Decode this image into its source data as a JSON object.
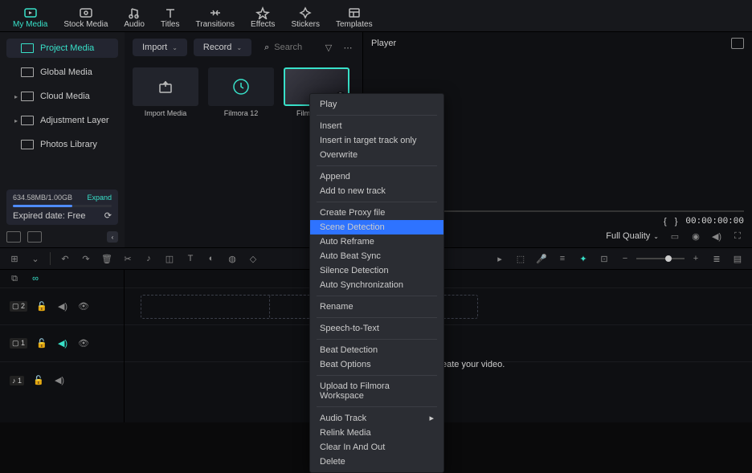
{
  "tabs": [
    {
      "label": "My Media",
      "name": "my-media",
      "active": true,
      "icon": "media"
    },
    {
      "label": "Stock Media",
      "name": "stock-media",
      "icon": "stock"
    },
    {
      "label": "Audio",
      "name": "audio",
      "icon": "audio"
    },
    {
      "label": "Titles",
      "name": "titles",
      "icon": "titles"
    },
    {
      "label": "Transitions",
      "name": "transitions",
      "icon": "transitions"
    },
    {
      "label": "Effects",
      "name": "effects",
      "icon": "effects"
    },
    {
      "label": "Stickers",
      "name": "stickers",
      "icon": "stickers"
    },
    {
      "label": "Templates",
      "name": "templates",
      "icon": "templates"
    }
  ],
  "sidebar": {
    "items": [
      {
        "label": "Project Media",
        "active": true,
        "caret": ""
      },
      {
        "label": "Global Media",
        "caret": ""
      },
      {
        "label": "Cloud Media",
        "caret": "▸"
      },
      {
        "label": "Adjustment Layer",
        "caret": "▸"
      },
      {
        "label": "Photos Library",
        "caret": ""
      }
    ]
  },
  "storage": {
    "text": "634.58MB/1.00GB",
    "expand": "Expand",
    "expired": "Expired date: Free"
  },
  "toolbar": {
    "import": "Import",
    "record": "Record",
    "search_ph": "Search"
  },
  "media": {
    "items": [
      {
        "label": "Import Media",
        "kind": "import"
      },
      {
        "label": "Filmora 12",
        "kind": "circle"
      },
      {
        "label": "Filmora Tu...",
        "kind": "video",
        "selected": true
      }
    ]
  },
  "player": {
    "title": "Player",
    "tc_in": "{",
    "tc_out": "}",
    "timecode": "00:00:00:00",
    "quality": "Full Quality"
  },
  "context": {
    "items": [
      {
        "label": "Play"
      },
      {
        "sep": true
      },
      {
        "label": "Insert"
      },
      {
        "label": "Insert in target track only"
      },
      {
        "label": "Overwrite"
      },
      {
        "sep": true
      },
      {
        "label": "Append"
      },
      {
        "label": "Add to new track"
      },
      {
        "sep": true
      },
      {
        "label": "Create Proxy file"
      },
      {
        "label": "Scene Detection",
        "hl": true
      },
      {
        "label": "Auto Reframe",
        "dis": true
      },
      {
        "label": "Auto Beat Sync"
      },
      {
        "label": "Silence Detection"
      },
      {
        "label": "Auto Synchronization",
        "dis": true
      },
      {
        "sep": true
      },
      {
        "label": "Rename"
      },
      {
        "sep": true
      },
      {
        "label": "Speech-to-Text"
      },
      {
        "sep": true
      },
      {
        "label": "Beat Detection",
        "dis": true
      },
      {
        "label": "Beat Options",
        "dis": true
      },
      {
        "sep": true
      },
      {
        "label": "Upload to Filmora Workspace"
      },
      {
        "sep": true
      },
      {
        "label": "Audio Track",
        "sub": true
      },
      {
        "label": "Relink Media"
      },
      {
        "label": "Clear In And Out",
        "dis": true
      },
      {
        "label": "Delete"
      }
    ]
  },
  "timeline": {
    "hint": "eate your video.",
    "tracks": [
      {
        "badge": "▢ 2",
        "lock": true,
        "audio": true,
        "eye": true
      },
      {
        "badge": "▢ 1",
        "lock": true,
        "audio": true,
        "eye": true,
        "accent": true
      },
      {
        "badge": "♪ 1",
        "lock": true,
        "audio": true
      }
    ]
  }
}
